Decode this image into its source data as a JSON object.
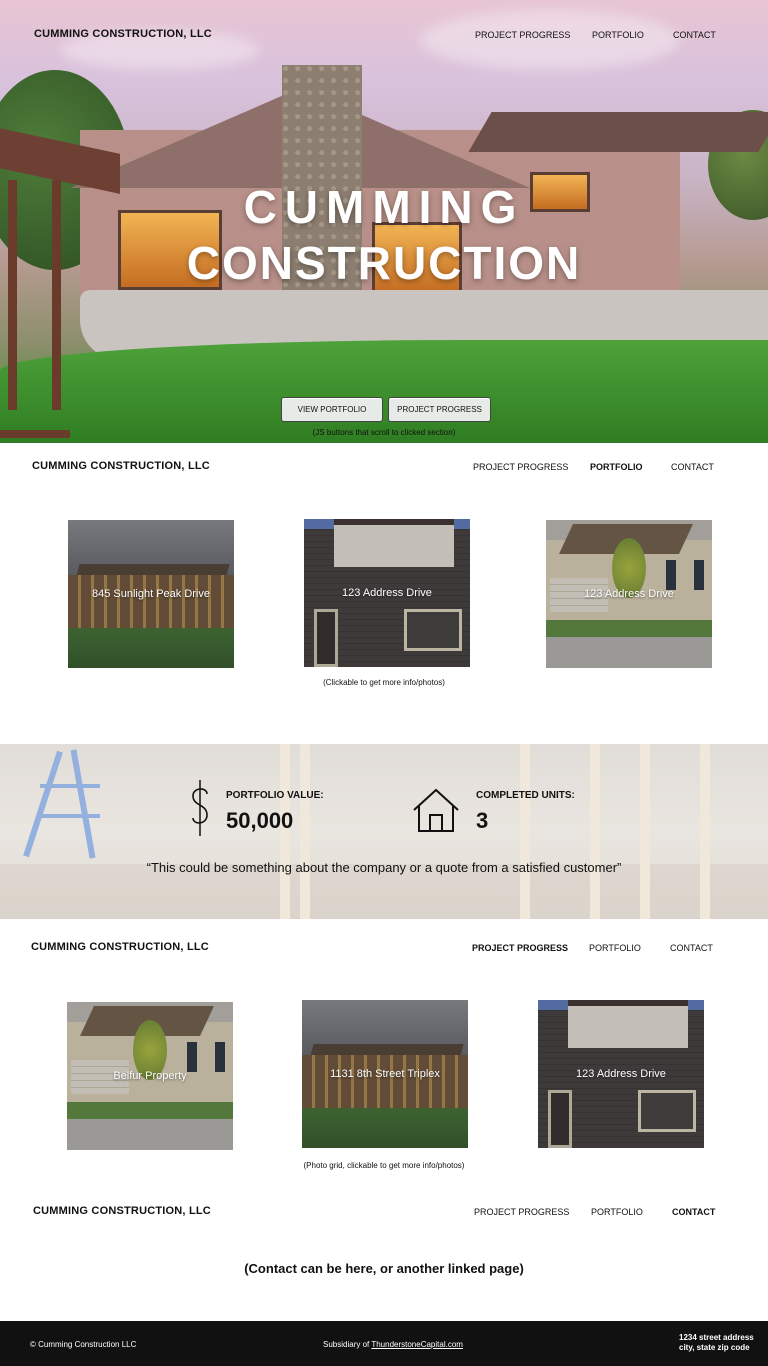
{
  "brand": "CUMMING CONSTRUCTION, LLC",
  "nav": {
    "project_progress": "PROJECT PROGRESS",
    "portfolio": "PORTFOLIO",
    "contact": "CONTACT"
  },
  "hero": {
    "title_line1": "CUMMING",
    "title_line2": "CONSTRUCTION",
    "btn_portfolio": "VIEW PORTFOLIO",
    "btn_progress": "PROJECT PROGRESS",
    "note": "(JS buttons that scroll to clicked section)"
  },
  "portfolio": {
    "cards": [
      {
        "caption": "845 Sunlight Peak Drive"
      },
      {
        "caption": "123 Address Drive"
      },
      {
        "caption": "123 Address Drive"
      }
    ],
    "note": "(Clickable to get more info/photos)"
  },
  "stats": {
    "value_label": "PORTFOLIO VALUE:",
    "value": "50,000",
    "units_label": "COMPLETED UNITS:",
    "units": "3",
    "quote": "“This could be something about the company or a quote from a satisfied customer”",
    "icons": [
      "dollar-icon",
      "house-icon"
    ]
  },
  "progress": {
    "cards": [
      {
        "caption": "Belfur Property"
      },
      {
        "caption": "1131 8th Street Triplex"
      },
      {
        "caption": "123 Address Drive"
      }
    ],
    "note": "(Photo grid, clickable to get more info/photos)"
  },
  "contact": {
    "note": "(Contact can be here, or another linked page)"
  },
  "footer": {
    "copyright": "© Cumming Construction LLC",
    "subsidiary_prefix": "Subsidiary of ",
    "subsidiary_link": "ThunderstoneCapital.com",
    "address_line1": "1234 street address",
    "address_line2": "city, state zip code"
  },
  "colors": {
    "footer_bg": "#111111",
    "lawn": "#3f8a2f",
    "button_bg": "#e7ebe7"
  }
}
